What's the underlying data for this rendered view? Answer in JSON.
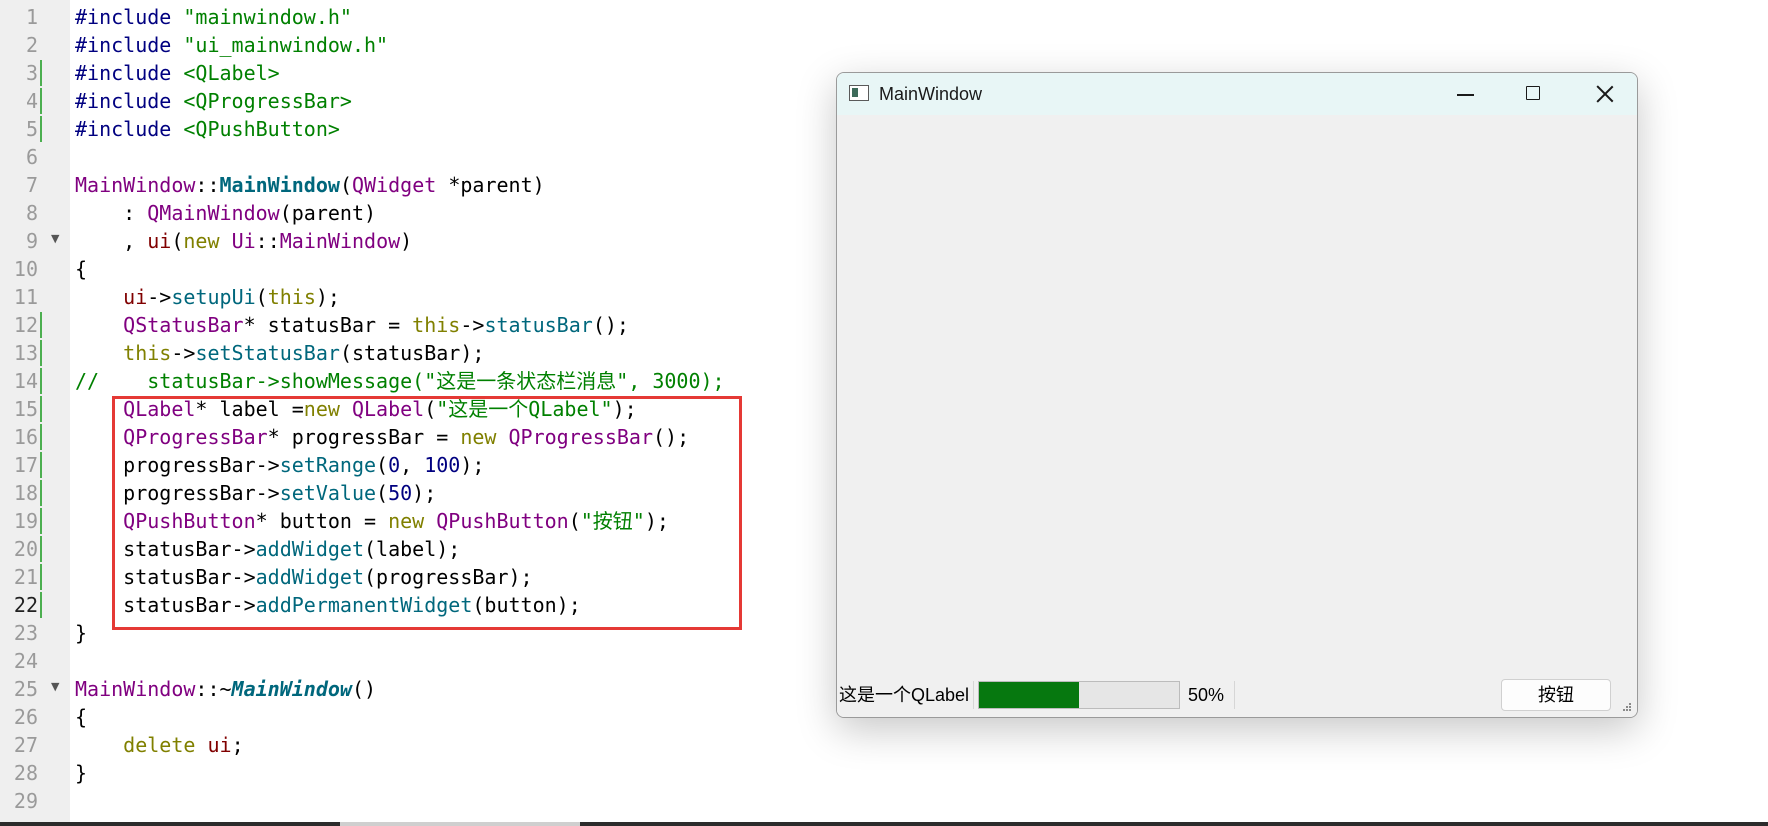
{
  "editor": {
    "language": "cpp",
    "lines": [
      {
        "number": "1",
        "tokens": [
          {
            "t": "#include ",
            "c": "pp"
          },
          {
            "t": "\"mainwindow.h\"",
            "c": "str"
          }
        ]
      },
      {
        "number": "2",
        "tokens": [
          {
            "t": "#include ",
            "c": "pp"
          },
          {
            "t": "\"ui_mainwindow.h\"",
            "c": "str"
          }
        ]
      },
      {
        "number": "3",
        "tokens": [
          {
            "t": "#include ",
            "c": "pp"
          },
          {
            "t": "<QLabel>",
            "c": "str"
          }
        ]
      },
      {
        "number": "4",
        "tokens": [
          {
            "t": "#include ",
            "c": "pp"
          },
          {
            "t": "<QProgressBar>",
            "c": "str"
          }
        ]
      },
      {
        "number": "5",
        "tokens": [
          {
            "t": "#include ",
            "c": "pp"
          },
          {
            "t": "<QPushButton>",
            "c": "str"
          }
        ]
      },
      {
        "number": "6",
        "tokens": []
      },
      {
        "number": "7",
        "tokens": [
          {
            "t": "MainWindow",
            "c": "type"
          },
          {
            "t": "::",
            "c": "p"
          },
          {
            "t": "MainWindow",
            "c": "fnb"
          },
          {
            "t": "(",
            "c": "p"
          },
          {
            "t": "QWidget",
            "c": "type"
          },
          {
            "t": " *parent)",
            "c": "p"
          }
        ]
      },
      {
        "number": "8",
        "tokens": [
          {
            "t": "    : ",
            "c": "p"
          },
          {
            "t": "QMainWindow",
            "c": "type"
          },
          {
            "t": "(parent)",
            "c": "p"
          }
        ]
      },
      {
        "number": "9",
        "tokens": [
          {
            "t": "    , ",
            "c": "p"
          },
          {
            "t": "ui",
            "c": "mem"
          },
          {
            "t": "(",
            "c": "p"
          },
          {
            "t": "new",
            "c": "kw"
          },
          {
            "t": " ",
            "c": "p"
          },
          {
            "t": "Ui",
            "c": "type"
          },
          {
            "t": "::",
            "c": "p"
          },
          {
            "t": "MainWindow",
            "c": "type"
          },
          {
            "t": ")",
            "c": "p"
          }
        ]
      },
      {
        "number": "10",
        "tokens": [
          {
            "t": "{",
            "c": "p"
          }
        ]
      },
      {
        "number": "11",
        "tokens": [
          {
            "t": "    ",
            "c": "p"
          },
          {
            "t": "ui",
            "c": "mem"
          },
          {
            "t": "->",
            "c": "p"
          },
          {
            "t": "setupUi",
            "c": "fn"
          },
          {
            "t": "(",
            "c": "p"
          },
          {
            "t": "this",
            "c": "kw"
          },
          {
            "t": ");",
            "c": "p"
          }
        ]
      },
      {
        "number": "12",
        "tokens": [
          {
            "t": "    ",
            "c": "p"
          },
          {
            "t": "QStatusBar",
            "c": "type"
          },
          {
            "t": "* statusBar = ",
            "c": "p"
          },
          {
            "t": "this",
            "c": "kw"
          },
          {
            "t": "->",
            "c": "p"
          },
          {
            "t": "statusBar",
            "c": "fn"
          },
          {
            "t": "();",
            "c": "p"
          }
        ]
      },
      {
        "number": "13",
        "tokens": [
          {
            "t": "    ",
            "c": "p"
          },
          {
            "t": "this",
            "c": "kw"
          },
          {
            "t": "->",
            "c": "p"
          },
          {
            "t": "setStatusBar",
            "c": "fn"
          },
          {
            "t": "(statusBar);",
            "c": "p"
          }
        ]
      },
      {
        "number": "14",
        "tokens": [
          {
            "t": "//    statusBar->showMessage(\"这是一条状态栏消息\", 3000);",
            "c": "cmt"
          }
        ]
      },
      {
        "number": "15",
        "tokens": [
          {
            "t": "    ",
            "c": "p"
          },
          {
            "t": "QLabel",
            "c": "type"
          },
          {
            "t": "* label =",
            "c": "p"
          },
          {
            "t": "new",
            "c": "kw"
          },
          {
            "t": " ",
            "c": "p"
          },
          {
            "t": "QLabel",
            "c": "type"
          },
          {
            "t": "(",
            "c": "p"
          },
          {
            "t": "\"这是一个QLabel\"",
            "c": "str"
          },
          {
            "t": ");",
            "c": "p"
          }
        ]
      },
      {
        "number": "16",
        "tokens": [
          {
            "t": "    ",
            "c": "p"
          },
          {
            "t": "QProgressBar",
            "c": "type"
          },
          {
            "t": "* progressBar = ",
            "c": "p"
          },
          {
            "t": "new",
            "c": "kw"
          },
          {
            "t": " ",
            "c": "p"
          },
          {
            "t": "QProgressBar",
            "c": "type"
          },
          {
            "t": "();",
            "c": "p"
          }
        ]
      },
      {
        "number": "17",
        "tokens": [
          {
            "t": "    progressBar->",
            "c": "p"
          },
          {
            "t": "setRange",
            "c": "fn"
          },
          {
            "t": "(",
            "c": "p"
          },
          {
            "t": "0",
            "c": "num"
          },
          {
            "t": ", ",
            "c": "p"
          },
          {
            "t": "100",
            "c": "num"
          },
          {
            "t": ");",
            "c": "p"
          }
        ]
      },
      {
        "number": "18",
        "tokens": [
          {
            "t": "    progressBar->",
            "c": "p"
          },
          {
            "t": "setValue",
            "c": "fn"
          },
          {
            "t": "(",
            "c": "p"
          },
          {
            "t": "50",
            "c": "num"
          },
          {
            "t": ");",
            "c": "p"
          }
        ]
      },
      {
        "number": "19",
        "tokens": [
          {
            "t": "    ",
            "c": "p"
          },
          {
            "t": "QPushButton",
            "c": "type"
          },
          {
            "t": "* button = ",
            "c": "p"
          },
          {
            "t": "new",
            "c": "kw"
          },
          {
            "t": " ",
            "c": "p"
          },
          {
            "t": "QPushButton",
            "c": "type"
          },
          {
            "t": "(",
            "c": "p"
          },
          {
            "t": "\"按钮\"",
            "c": "str"
          },
          {
            "t": ");",
            "c": "p"
          }
        ]
      },
      {
        "number": "20",
        "tokens": [
          {
            "t": "    statusBar->",
            "c": "p"
          },
          {
            "t": "addWidget",
            "c": "fn"
          },
          {
            "t": "(label);",
            "c": "p"
          }
        ]
      },
      {
        "number": "21",
        "tokens": [
          {
            "t": "    statusBar->",
            "c": "p"
          },
          {
            "t": "addWidget",
            "c": "fn"
          },
          {
            "t": "(progressBar);",
            "c": "p"
          }
        ]
      },
      {
        "number": "22",
        "tokens": [
          {
            "t": "    statusBar->",
            "c": "p"
          },
          {
            "t": "addPermanentWidget",
            "c": "fn"
          },
          {
            "t": "(button);",
            "c": "p"
          }
        ]
      },
      {
        "number": "23",
        "tokens": [
          {
            "t": "}",
            "c": "p"
          }
        ]
      },
      {
        "number": "24",
        "tokens": []
      },
      {
        "number": "25",
        "tokens": [
          {
            "t": "MainWindow",
            "c": "type"
          },
          {
            "t": "::~",
            "c": "p"
          },
          {
            "t": "MainWindow",
            "c": "fnbi"
          },
          {
            "t": "()",
            "c": "p"
          }
        ]
      },
      {
        "number": "26",
        "tokens": [
          {
            "t": "{",
            "c": "p"
          }
        ]
      },
      {
        "number": "27",
        "tokens": [
          {
            "t": "    ",
            "c": "p"
          },
          {
            "t": "delete",
            "c": "kw"
          },
          {
            "t": " ",
            "c": "p"
          },
          {
            "t": "ui",
            "c": "mem"
          },
          {
            "t": ";",
            "c": "p"
          }
        ]
      },
      {
        "number": "28",
        "tokens": [
          {
            "t": "}",
            "c": "p"
          }
        ]
      },
      {
        "number": "29",
        "tokens": []
      }
    ],
    "changed_lines": [
      "3",
      "4",
      "5",
      "12",
      "13",
      "14",
      "15",
      "16",
      "17",
      "18",
      "19",
      "20",
      "21",
      "22"
    ],
    "fold_lines": [
      "9",
      "25"
    ],
    "current_line": "22",
    "highlight_color": "#e53935"
  },
  "window": {
    "title": "MainWindow",
    "icon": "window-app-icon",
    "controls": {
      "minimize": "minimize-icon",
      "maximize": "maximize-icon",
      "close": "close-icon"
    },
    "statusbar": {
      "label": "这是一个QLabel",
      "progress": {
        "min": 0,
        "max": 100,
        "value": 50,
        "text": "50%",
        "fill_color": "#06780f"
      },
      "button_label": "按钮"
    }
  }
}
